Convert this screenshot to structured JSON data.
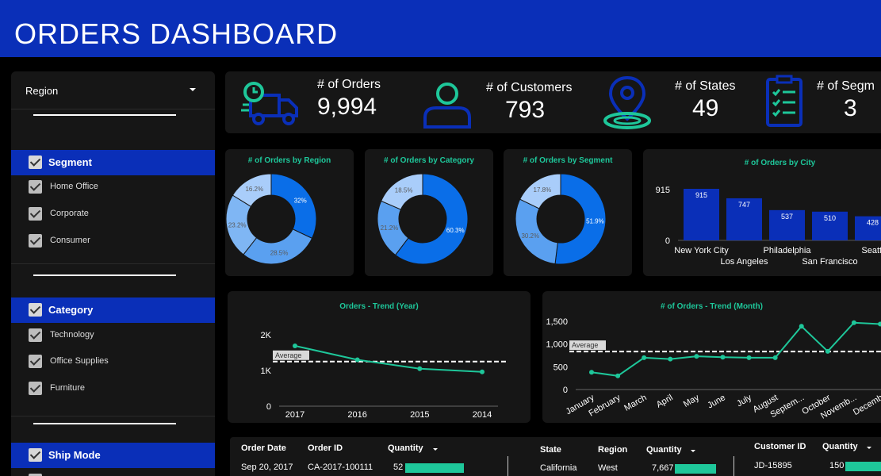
{
  "header": {
    "title": "ORDERS DASHBOARD"
  },
  "sidebar": {
    "region_label": "Region",
    "segment": {
      "label": "Segment",
      "items": [
        "Home Office",
        "Corporate",
        "Consumer"
      ]
    },
    "category": {
      "label": "Category",
      "items": [
        "Technology",
        "Office Supplies",
        "Furniture"
      ]
    },
    "ship_mode": {
      "label": "Ship Mode"
    }
  },
  "kpis": [
    {
      "label": "# of Orders",
      "value": "9,994",
      "icon": "delivery-truck-icon"
    },
    {
      "label": "# of Customers",
      "value": "793",
      "icon": "user-icon"
    },
    {
      "label": "# of States",
      "value": "49",
      "icon": "map-pin-icon"
    },
    {
      "label": "# of Segm",
      "value": "3",
      "icon": "checklist-icon"
    }
  ],
  "colors": {
    "accent": "#1ec79a",
    "brand": "#0a2fb8",
    "donut_dark": "#0a6ee8",
    "donut_mid": "#5aa0f0",
    "donut_light": "#a9cdfa"
  },
  "chart_data": [
    {
      "type": "pie",
      "title": "# of Orders by Region",
      "labels": [
        "",
        "",
        "",
        ""
      ],
      "values": [
        32,
        28.5,
        23.2,
        16.2
      ],
      "value_labels": [
        "32%",
        "28.5%",
        "23.2%",
        "16.2%"
      ]
    },
    {
      "type": "pie",
      "title": "# of Orders by Category",
      "labels": [
        "",
        "",
        ""
      ],
      "values": [
        60.3,
        21.2,
        18.5
      ],
      "value_labels": [
        "60.3%",
        "21.2%",
        "18.5%"
      ]
    },
    {
      "type": "pie",
      "title": "# of Orders by Segment",
      "labels": [
        "",
        "",
        ""
      ],
      "values": [
        51.9,
        30.2,
        17.8
      ],
      "value_labels": [
        "51.9%",
        "30.2%",
        "17.8%"
      ]
    },
    {
      "type": "bar",
      "title": "# of Orders by City",
      "categories": [
        "New York City",
        "Los Angeles",
        "Philadelphia",
        "San Francisco",
        "Seattle"
      ],
      "visible_category_labels": [
        "New York City",
        "Los Angeles",
        "Philadelphia",
        "San Francisco",
        "Seattl"
      ],
      "values": [
        915,
        747,
        537,
        510,
        428
      ],
      "value_labels": [
        "915",
        "747",
        "537",
        "510",
        "428"
      ],
      "yticks": [
        "915",
        "0"
      ],
      "ylim": [
        0,
        915
      ]
    },
    {
      "type": "line",
      "title": "Orders - Trend (Year)",
      "categories": [
        "2017",
        "2016",
        "2015",
        "2014"
      ],
      "values": [
        1690,
        1300,
        1050,
        960
      ],
      "yticks": [
        "2K",
        "1K",
        "0"
      ],
      "ylim": [
        0,
        2000
      ],
      "reference_line": {
        "label": "Average",
        "value": 1250
      }
    },
    {
      "type": "line",
      "title": "# of Orders - Trend (Month)",
      "categories": [
        "January",
        "February",
        "March",
        "April",
        "May",
        "June",
        "July",
        "August",
        "Septem...",
        "October",
        "Novemb...",
        "Decemb"
      ],
      "values": [
        380,
        300,
        700,
        670,
        730,
        710,
        700,
        700,
        1390,
        840,
        1470,
        1440
      ],
      "yticks": [
        "1,500",
        "1,000",
        "500",
        "0"
      ],
      "ylim": [
        0,
        1500
      ],
      "reference_line": {
        "label": "Average",
        "value": 835
      }
    }
  ],
  "tables": [
    {
      "columns": [
        "Order Date",
        "Order ID",
        "Quantity"
      ],
      "rows": [
        {
          "cells": [
            "Sep 20, 2017",
            "CA-2017-100111",
            "52"
          ],
          "bar_fraction": 0.75
        }
      ]
    },
    {
      "columns": [
        "State",
        "Region",
        "Quantity"
      ],
      "rows": [
        {
          "cells": [
            "California",
            "West",
            "7,667"
          ],
          "bar_fraction": 0.9
        }
      ]
    },
    {
      "columns": [
        "Customer ID",
        "Quantity"
      ],
      "rows": [
        {
          "cells": [
            "JD-15895",
            "150"
          ],
          "bar_fraction": 0.9
        }
      ]
    }
  ]
}
